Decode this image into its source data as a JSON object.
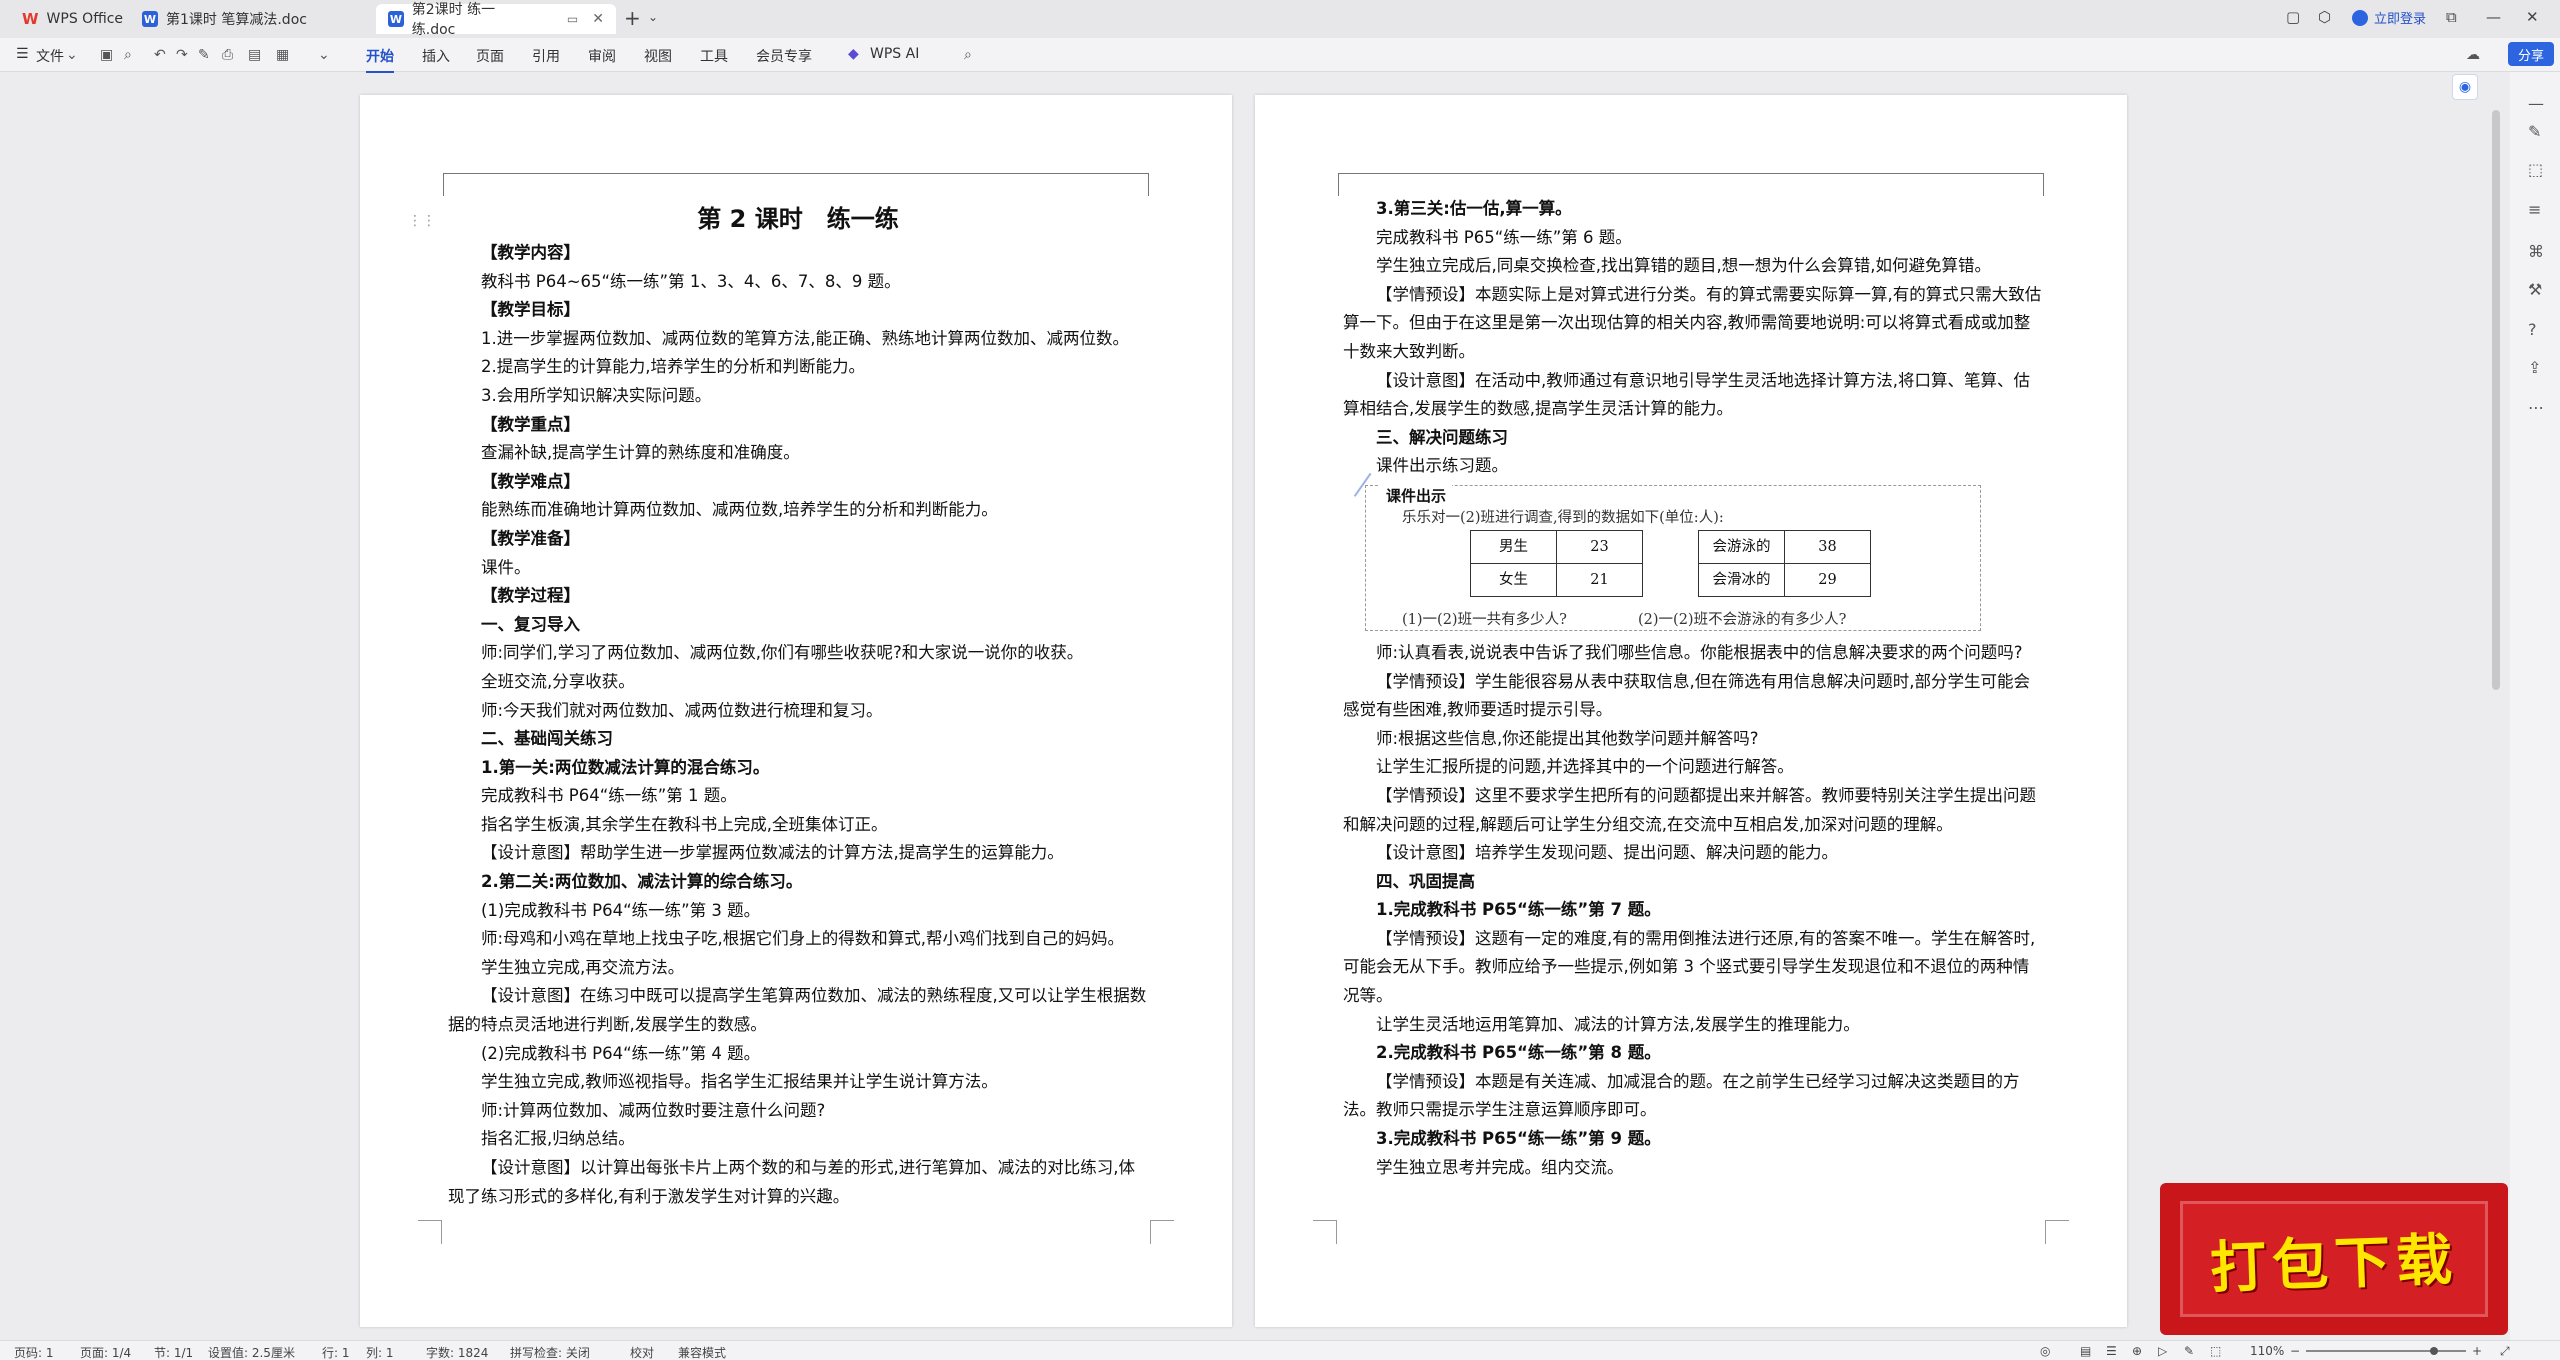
{
  "tabs": {
    "app": "WPS Office",
    "doc1": "第1课时 笔算减法.doc",
    "doc2": "第2课时 练一练.doc"
  },
  "titlebar": {
    "login": "立即登录"
  },
  "toolbar": {
    "file": "文件",
    "menus": [
      "开始",
      "插入",
      "页面",
      "引用",
      "审阅",
      "视图",
      "工具",
      "会员专享",
      "WPS AI"
    ],
    "share": "分享"
  },
  "page1": {
    "title": "第 2 课时　练一练",
    "paras": [
      {
        "t": "【教学内容】",
        "cls": "b"
      },
      {
        "t": "教科书 P64~65“练一练”第 1、3、4、6、7、8、9 题。",
        "cls": ""
      },
      {
        "t": "【教学目标】",
        "cls": "b"
      },
      {
        "t": "1.进一步掌握两位数加、减两位数的笔算方法,能正确、熟练地计算两位数加、减两位数。",
        "cls": ""
      },
      {
        "t": "2.提高学生的计算能力,培养学生的分析和判断能力。",
        "cls": ""
      },
      {
        "t": "3.会用所学知识解决实际问题。",
        "cls": ""
      },
      {
        "t": "【教学重点】",
        "cls": "b"
      },
      {
        "t": "查漏补缺,提高学生计算的熟练度和准确度。",
        "cls": ""
      },
      {
        "t": "【教学难点】",
        "cls": "b"
      },
      {
        "t": "能熟练而准确地计算两位数加、减两位数,培养学生的分析和判断能力。",
        "cls": ""
      },
      {
        "t": "【教学准备】",
        "cls": "b"
      },
      {
        "t": "课件。",
        "cls": ""
      },
      {
        "t": "【教学过程】",
        "cls": "b"
      },
      {
        "t": "一、复习导入",
        "cls": "b"
      },
      {
        "t": "师:同学们,学习了两位数加、减两位数,你们有哪些收获呢?和大家说一说你的收获。",
        "cls": ""
      },
      {
        "t": "全班交流,分享收获。",
        "cls": ""
      },
      {
        "t": "师:今天我们就对两位数加、减两位数进行梳理和复习。",
        "cls": ""
      },
      {
        "t": "二、基础闯关练习",
        "cls": "b"
      },
      {
        "t": "1.第一关:两位数减法计算的混合练习。",
        "cls": "b"
      },
      {
        "t": "完成教科书 P64“练一练”第 1 题。",
        "cls": ""
      },
      {
        "t": "指名学生板演,其余学生在教科书上完成,全班集体订正。",
        "cls": ""
      },
      {
        "t": "【设计意图】帮助学生进一步掌握两位数减法的计算方法,提高学生的运算能力。",
        "cls": "di"
      },
      {
        "t": "2.第二关:两位数加、减法计算的综合练习。",
        "cls": "b"
      },
      {
        "t": "(1)完成教科书 P64“练一练”第 3 题。",
        "cls": ""
      },
      {
        "t": "师:母鸡和小鸡在草地上找虫子吃,根据它们身上的得数和算式,帮小鸡们找到自己的妈妈。",
        "cls": ""
      },
      {
        "t": "学生独立完成,再交流方法。",
        "cls": ""
      },
      {
        "t": "【设计意图】在练习中既可以提高学生笔算两位数加、减法的熟练程度,又可以让学生根据数据的特点灵活地进行判断,发展学生的数感。",
        "cls": "di"
      },
      {
        "t": "(2)完成教科书 P64“练一练”第 4 题。",
        "cls": ""
      },
      {
        "t": "学生独立完成,教师巡视指导。指名学生汇报结果并让学生说计算方法。",
        "cls": ""
      },
      {
        "t": "师:计算两位数加、减两位数时要注意什么问题?",
        "cls": ""
      },
      {
        "t": "指名汇报,归纳总结。",
        "cls": ""
      },
      {
        "t": "【设计意图】以计算出每张卡片上两个数的和与差的形式,进行笔算加、减法的对比练习,体现了练习形式的多样化,有利于激发学生对计算的兴趣。",
        "cls": "di"
      }
    ]
  },
  "page2": {
    "before": [
      {
        "t": "3.第三关:估一估,算一算。",
        "cls": "b"
      },
      {
        "t": "完成教科书 P65“练一练”第 6 题。",
        "cls": ""
      },
      {
        "t": "学生独立完成后,同桌交换检查,找出算错的题目,想一想为什么会算错,如何避免算错。",
        "cls": ""
      },
      {
        "t": "【学情预设】本题实际上是对算式进行分类。有的算式需要实际算一算,有的算式只需大致估算一下。但由于在这里是第一次出现估算的相关内容,教师需简要地说明:可以将算式看成或加整十数来大致判断。",
        "cls": "di"
      },
      {
        "t": "【设计意图】在活动中,教师通过有意识地引导学生灵活地选择计算方法,将口算、笔算、估算相结合,发展学生的数感,提高学生灵活计算的能力。",
        "cls": "di"
      },
      {
        "t": "三、解决问题练习",
        "cls": "b"
      },
      {
        "t": "课件出示练习题。",
        "cls": ""
      }
    ],
    "figure": {
      "title": "课件出示",
      "intro": "乐乐对一(2)班进行调查,得到的数据如下(单位:人):",
      "table1": [
        [
          "男生",
          "23"
        ],
        [
          "女生",
          "21"
        ]
      ],
      "table2": [
        [
          "会游泳的",
          "38"
        ],
        [
          "会滑冰的",
          "29"
        ]
      ],
      "q1": "(1)一(2)班一共有多少人?",
      "q2": "(2)一(2)班不会游泳的有多少人?"
    },
    "after": [
      {
        "t": "师:认真看表,说说表中告诉了我们哪些信息。你能根据表中的信息解决要求的两个问题吗?",
        "cls": ""
      },
      {
        "t": "【学情预设】学生能很容易从表中获取信息,但在筛选有用信息解决问题时,部分学生可能会感觉有些困难,教师要适时提示引导。",
        "cls": "di"
      },
      {
        "t": "师:根据这些信息,你还能提出其他数学问题并解答吗?",
        "cls": ""
      },
      {
        "t": "让学生汇报所提的问题,并选择其中的一个问题进行解答。",
        "cls": ""
      },
      {
        "t": "【学情预设】这里不要求学生把所有的问题都提出来并解答。教师要特别关注学生提出问题和解决问题的过程,解题后可让学生分组交流,在交流中互相启发,加深对问题的理解。",
        "cls": "di"
      },
      {
        "t": "【设计意图】培养学生发现问题、提出问题、解决问题的能力。",
        "cls": "di"
      },
      {
        "t": "四、巩固提高",
        "cls": "b"
      },
      {
        "t": "1.完成教科书 P65“练一练”第 7 题。",
        "cls": "b"
      },
      {
        "t": "【学情预设】这题有一定的难度,有的需用倒推法进行还原,有的答案不唯一。学生在解答时,可能会无从下手。教师应给予一些提示,例如第 3 个竖式要引导学生发现退位和不退位的两种情况等。",
        "cls": "di"
      },
      {
        "t": "让学生灵活地运用笔算加、减法的计算方法,发展学生的推理能力。",
        "cls": ""
      },
      {
        "t": "2.完成教科书 P65“练一练”第 8 题。",
        "cls": "b"
      },
      {
        "t": "【学情预设】本题是有关连减、加减混合的题。在之前学生已经学习过解决这类题目的方法。教师只需提示学生注意运算顺序即可。",
        "cls": "di"
      },
      {
        "t": "3.完成教科书 P65“练一练”第 9 题。",
        "cls": "b"
      },
      {
        "t": "学生独立思考并完成。组内交流。",
        "cls": ""
      }
    ]
  },
  "statusbar": {
    "page": "页码: 1",
    "pages": "页面: 1/4",
    "section": "节: 1/1",
    "setting": "设置值: 2.5厘米",
    "row": "行: 1",
    "col": "列: 1",
    "words": "字数: 1824",
    "spell": "拼写检查: 关闭",
    "proof": "校对",
    "compat": "兼容模式",
    "zoom": "110%"
  },
  "badge": {
    "text": "打包下载"
  }
}
